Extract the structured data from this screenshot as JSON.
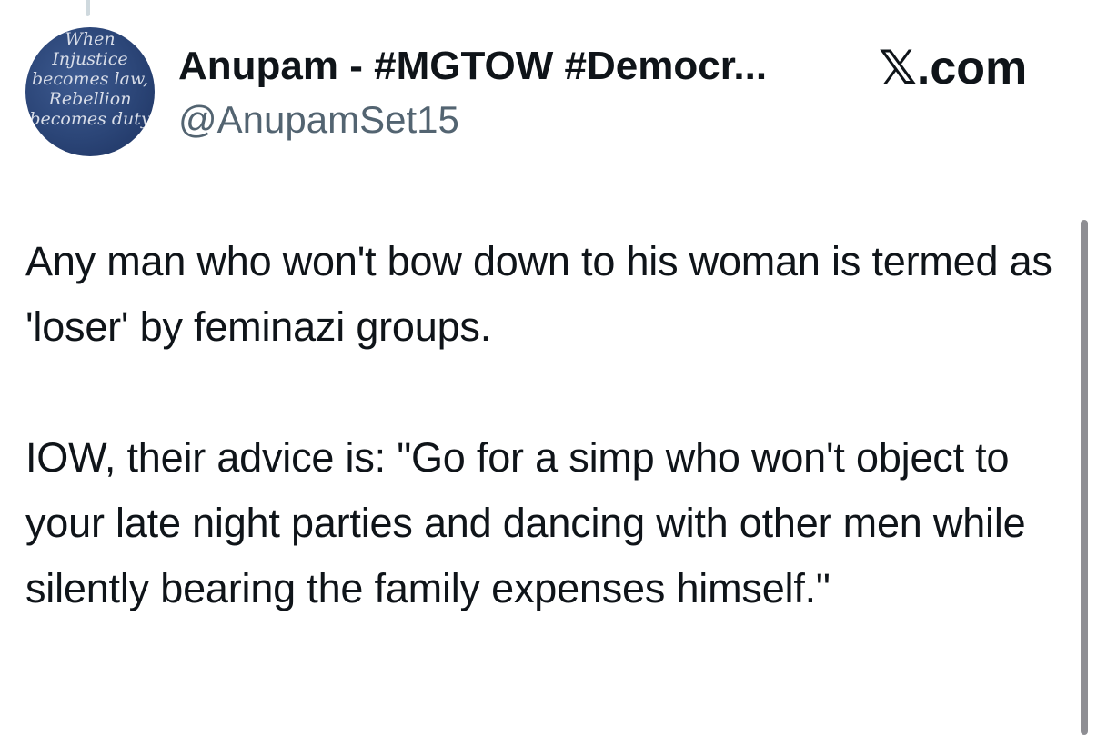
{
  "tweet": {
    "author": {
      "display_name": "Anupam - #MGTOW #Democr...",
      "handle": "@AnupamSet15",
      "avatar_text": [
        "When",
        "Injustice",
        "becomes law,",
        "Rebellion",
        "becomes duty"
      ]
    },
    "brand": "𝕏.com",
    "body": [
      "Any man who won't bow down to his woman is termed as 'loser' by feminazi groups.",
      "IOW, their advice is: \"Go for a simp who won't object to your late night parties and dancing with other men while silently bearing the family expenses himself.\""
    ]
  },
  "colors": {
    "text_primary": "#0f1419",
    "text_secondary": "#536471",
    "avatar_bg": "#2b4577",
    "thread_line": "#cfd9de"
  }
}
